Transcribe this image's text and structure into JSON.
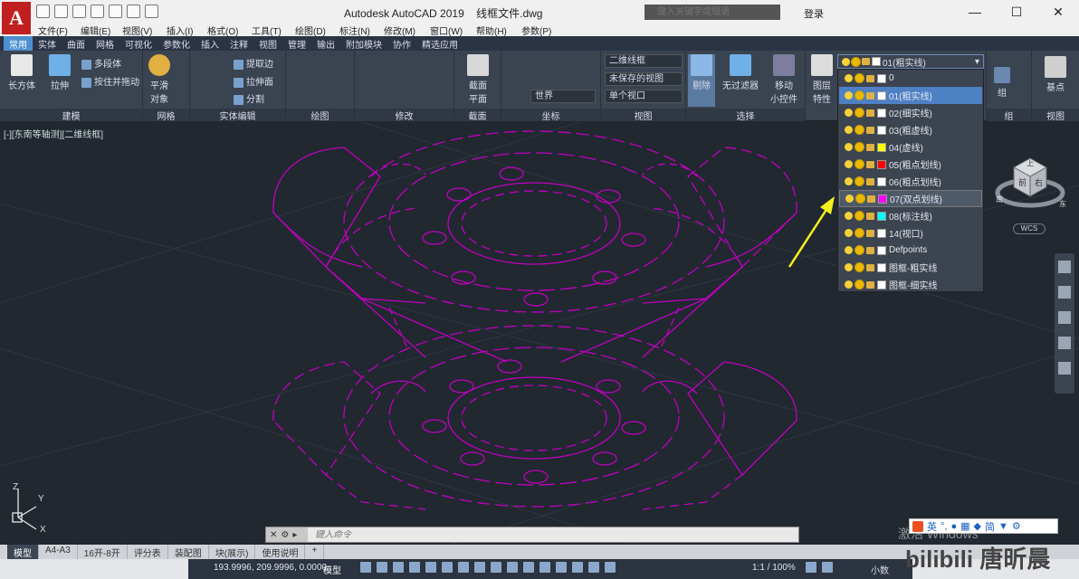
{
  "app": {
    "title": "Autodesk AutoCAD 2019",
    "file": "线框文件.dwg",
    "logo": "A"
  },
  "search": {
    "placeholder": "键入关键字或短语"
  },
  "login": "登录",
  "menu": [
    "文件(F)",
    "编辑(E)",
    "视图(V)",
    "插入(I)",
    "格式(O)",
    "工具(T)",
    "绘图(D)",
    "标注(N)",
    "修改(M)",
    "窗口(W)",
    "帮助(H)",
    "参数(P)"
  ],
  "tabs": [
    "常用",
    "实体",
    "曲面",
    "网格",
    "可视化",
    "参数化",
    "插入",
    "注释",
    "视图",
    "管理",
    "输出",
    "附加模块",
    "协作",
    "精选应用"
  ],
  "ribbon": {
    "modeling": {
      "title": "建模",
      "box": "长方体",
      "extrude": "拉伸",
      "polysolid": "多段体",
      "presspull": "按住并拖动"
    },
    "mesh": {
      "title": "网格",
      "smooth1": "平滑",
      "smooth2": "对象"
    },
    "solidedit": {
      "title": "实体编辑",
      "extract": "提取边",
      "extrudeface": "拉伸面",
      "separate": "分割"
    },
    "draw": {
      "title": "绘图"
    },
    "modify": {
      "title": "修改"
    },
    "section": {
      "title": "截面",
      "plane1": "截面",
      "plane2": "平面"
    },
    "coords": {
      "title": "坐标",
      "world": "世界"
    },
    "view": {
      "title": "视图",
      "visual": "二维线框",
      "saved": "未保存的视图",
      "viewport": "单个视口"
    },
    "selection": {
      "title": "选择",
      "cull": "剔除",
      "nofilter": "无过滤器",
      "gizmo1": "移动",
      "gizmo2": "小控件"
    },
    "layers": {
      "props1": "图层",
      "props2": "特性"
    },
    "groups": {
      "title": "组",
      "group": "组"
    },
    "viewpanel": {
      "title": "视图",
      "base": "基点"
    }
  },
  "layer_current": "01(粗实线)",
  "layers": [
    {
      "name": "0",
      "color": "#ffffff"
    },
    {
      "name": "01(粗实线)",
      "color": "#ffffff"
    },
    {
      "name": "02(细实线)",
      "color": "#ffffff"
    },
    {
      "name": "03(粗虚线)",
      "color": "#ffffff"
    },
    {
      "name": "04(虚线)",
      "color": "#ffff00"
    },
    {
      "name": "05(粗点划线)",
      "color": "#ff0000"
    },
    {
      "name": "06(粗点划线)",
      "color": "#ffffff"
    },
    {
      "name": "07(双点划线)",
      "color": "#ff00ff"
    },
    {
      "name": "08(标注线)",
      "color": "#00ffff"
    },
    {
      "name": "14(视口)",
      "color": "#ffffff"
    },
    {
      "name": "Defpoints",
      "color": "#ffffff"
    },
    {
      "name": "图框-粗实线",
      "color": "#ffffff"
    },
    {
      "name": "图框-细实线",
      "color": "#ffffff"
    }
  ],
  "viewport": {
    "label": "[-][东南等轴测][二维线框]",
    "wcs": "WCS",
    "cube_top": "上",
    "cube_front": "前",
    "cube_right": "右",
    "compass_s": "南",
    "compass_e": "东"
  },
  "ucs": {
    "x": "X",
    "y": "Y",
    "z": "Z"
  },
  "command": {
    "placeholder": "键入命令"
  },
  "layout_tabs": [
    "模型",
    "A4-A3",
    "16开-8开",
    "评分表",
    "装配图",
    "块(展示)",
    "使用说明"
  ],
  "status": {
    "coords": "193.9996, 209.9996, 0.0000",
    "model": "模型",
    "scale": "1:1 / 100%",
    "decimal": "小数"
  },
  "ime": {
    "lang": "英",
    "mode": "简"
  },
  "watermark": {
    "activate": "激活 Windows",
    "brand": "bilibili 唐昕晨"
  },
  "colors": {
    "drawing": "#c000c0",
    "accent": "#4c90d0",
    "arrow": "#f4f020"
  }
}
